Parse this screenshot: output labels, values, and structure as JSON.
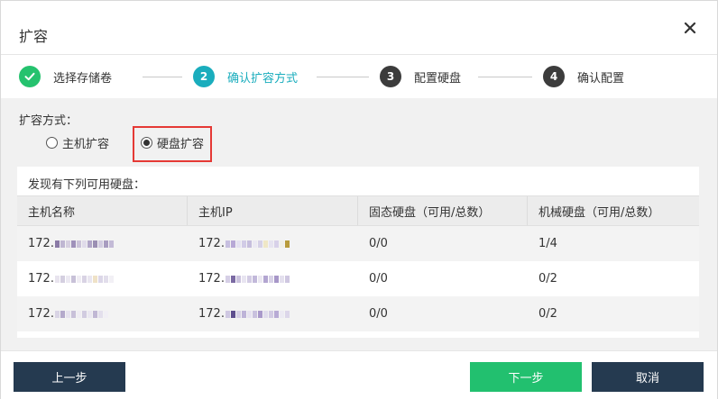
{
  "dialog": {
    "title": "扩容"
  },
  "steps": [
    {
      "number": "✓",
      "label": "选择存储卷",
      "state": "done"
    },
    {
      "number": "2",
      "label": "确认扩容方式",
      "state": "active"
    },
    {
      "number": "3",
      "label": "配置硬盘",
      "state": "pending"
    },
    {
      "number": "4",
      "label": "确认配置",
      "state": "pending"
    }
  ],
  "mode": {
    "label": "扩容方式：",
    "options": [
      {
        "label": "主机扩容",
        "selected": false
      },
      {
        "label": "硬盘扩容",
        "selected": true
      }
    ]
  },
  "disks": {
    "found_text": "发现有下列可用硬盘：",
    "columns": [
      "主机名称",
      "主机IP",
      "固态硬盘（可用/总数）",
      "机械硬盘（可用/总数）"
    ],
    "rows": [
      {
        "host": "172.",
        "ip": "172.",
        "ssd": "0/0",
        "hdd": "1/4"
      },
      {
        "host": "172.",
        "ip": "172.",
        "ssd": "0/0",
        "hdd": "0/2"
      },
      {
        "host": "172.",
        "ip": "172.",
        "ssd": "0/0",
        "hdd": "0/2"
      }
    ]
  },
  "footer": {
    "prev": "上一步",
    "next": "下一步",
    "cancel": "取消"
  },
  "colors": {
    "done": "#25c26e",
    "active": "#1aadbd",
    "pending": "#3c3c3c",
    "next_button": "#22c06f",
    "dark_button": "#253a50",
    "highlight": "#e53935"
  },
  "icons": {
    "close": "close-icon",
    "step_done": "check-icon"
  }
}
